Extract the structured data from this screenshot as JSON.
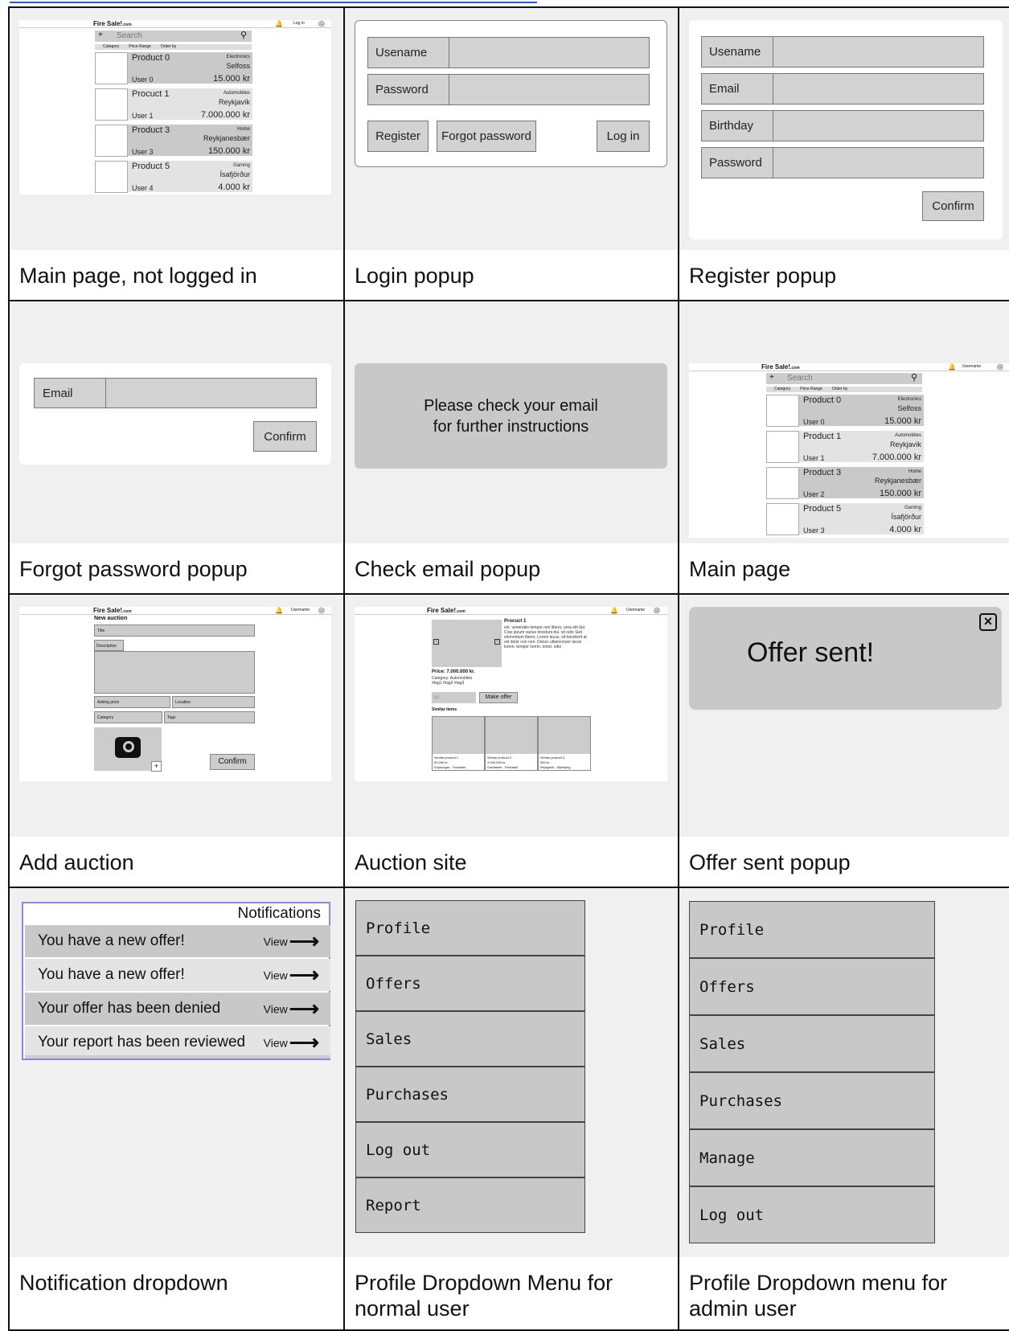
{
  "cells": [
    {
      "caption": "Main page, not logged in"
    },
    {
      "caption": "Login popup"
    },
    {
      "caption": "Register popup"
    },
    {
      "caption": "Forgot password popup"
    },
    {
      "caption": "Check email popup"
    },
    {
      "caption": "Main page"
    },
    {
      "caption": "Add auction"
    },
    {
      "caption": "Auction site"
    },
    {
      "caption": "Offer sent popup"
    },
    {
      "caption": "Notification dropdown"
    },
    {
      "caption": "Profile Dropdown Menu for normal user"
    },
    {
      "caption": "Profile Dropdown menu for admin user"
    }
  ],
  "site": {
    "logo": "Fire Sale!",
    "logo_suffix": ".com",
    "login": "Log in",
    "username": "Username"
  },
  "search": {
    "add": "+",
    "placeholder": "Search",
    "icon": "search-icon"
  },
  "filters": [
    "Category",
    "Price Range",
    "Order by"
  ],
  "products_a": [
    {
      "name": "Product 0",
      "cat": "Electronics",
      "loc": "Selfoss",
      "user": "User 0",
      "price": "15.000 kr"
    },
    {
      "name": "Procuct 1",
      "cat": "Automobiles",
      "loc": "Reykjavík",
      "user": "User 1",
      "price": "7.000.000 kr"
    },
    {
      "name": "Product 3",
      "cat": "Home",
      "loc": "Reykjanesbær",
      "user": "User 3",
      "price": "150.000 kr"
    },
    {
      "name": "Product 5",
      "cat": "Gaming",
      "loc": "Ísafjörður",
      "user": "User 4",
      "price": "4.000 kr"
    }
  ],
  "products_b": [
    {
      "name": "Product 0",
      "cat": "Electronics",
      "loc": "Selfoss",
      "user": "User 0",
      "price": "15.000 kr"
    },
    {
      "name": "Product 1",
      "cat": "Automobiles",
      "loc": "Reykjavík",
      "user": "User 1",
      "price": "7.000.000 kr"
    },
    {
      "name": "Product 3",
      "cat": "Home",
      "loc": "Reykjanesbær",
      "user": "User 2",
      "price": "150.000 kr"
    },
    {
      "name": "Product 5",
      "cat": "Gaming",
      "loc": "Ísafjörður",
      "user": "User 3",
      "price": "4.000 kr"
    }
  ],
  "login": {
    "username": "Usename",
    "password": "Password",
    "register": "Register",
    "forgot": "Forgot password",
    "login": "Log in"
  },
  "register": {
    "username": "Usename",
    "email": "Email",
    "birthday": "Birthday",
    "password": "Password",
    "confirm": "Confirm"
  },
  "forgot": {
    "email": "Email",
    "confirm": "Confirm"
  },
  "checkemail": {
    "line1": "Please check your email",
    "line2": "for further instructions"
  },
  "addauction": {
    "heading": "New auction",
    "title": "Title",
    "description": "Description",
    "asking": "Asking price",
    "location": "Location",
    "category": "Category",
    "tags": "Tags",
    "plus": "+",
    "confirm": "Confirm"
  },
  "auction": {
    "product": "Procuct 1",
    "desc": "est. venenatis tempor non libero, urna elit dui. Cras ipsum varius tincidunt dui. sit odio Sed elementum libero, Lorem lacus, sit hendrerit at vel dolor non non. Donec ullamcorper lacus lorem. tempor lorem. tortor. odio",
    "price": "Price: 7.000.000 kr.",
    "category": "Category: Automobiles",
    "tags": "#tag1 #tag2 #tag3",
    "kr": "kr.",
    "make_offer": "Make offer",
    "similar": "Similar items",
    "similar_items": [
      {
        "name": "Similar product 1",
        "price": "50.000 kr.",
        "loc": "Kópavogur - Farsíaski"
      },
      {
        "name": "Similar product 2",
        "price": "4.000.000 kr.",
        "loc": "Garðabær - Farsíaski"
      },
      {
        "name": "Similar product 3",
        "price": "500 kr.",
        "loc": "Reykjavík - Afþreying"
      }
    ]
  },
  "offer": {
    "text": "Offer sent!",
    "close": "×"
  },
  "notifications": {
    "title": "Notifications",
    "view": "View",
    "items": [
      "You have a new offer!",
      "You have a new offer!",
      "Your offer has been denied",
      "Your report has been reviewed"
    ]
  },
  "menu_user": [
    "Profile",
    "Offers",
    "Sales",
    "Purchases",
    "Log out",
    "Report"
  ],
  "menu_admin": [
    "Profile",
    "Offers",
    "Sales",
    "Purchases",
    "Manage",
    "Log out"
  ]
}
